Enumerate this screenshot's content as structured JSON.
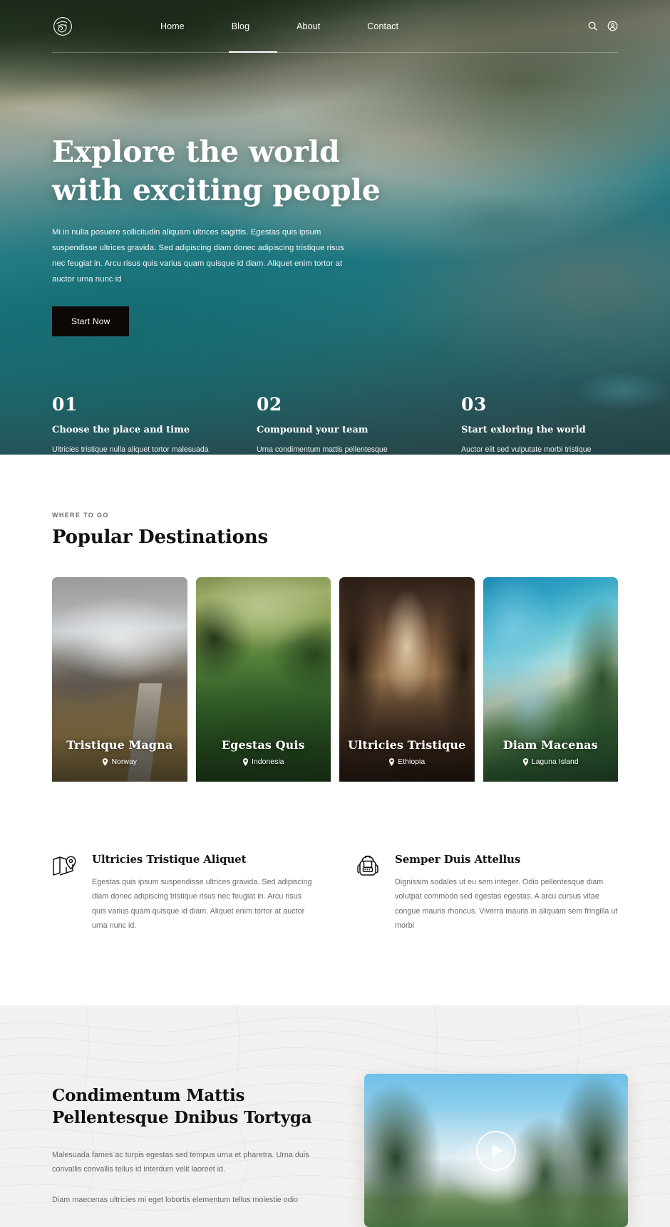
{
  "header": {
    "logo_icon": "wave-circle-logo",
    "nav": [
      {
        "label": "Home",
        "active": true
      },
      {
        "label": "Blog",
        "active": false
      },
      {
        "label": "About",
        "active": false
      },
      {
        "label": "Contact",
        "active": false
      }
    ],
    "actions": [
      {
        "icon": "search-icon"
      },
      {
        "icon": "user-account-icon"
      }
    ]
  },
  "hero": {
    "title_line1": "Explore the world",
    "title_line2": "with exciting people",
    "paragraph": "Mi in nulla posuere sollicitudin aliquam ultrices sagittis. Egestas quis ipsum suspendisse ultrices gravida. Sed adipiscing diam donec adipiscing tristique risus nec feugiat in. Arcu risus quis varius quam quisque id diam. Aliquet enim tortor at auctor urna nunc id",
    "cta_label": "Start Now",
    "cta_bg": "#0d0806",
    "steps": [
      {
        "number": "01",
        "title": "Choose the place and time",
        "text": "Ultricies tristique nulla aliquet tortor malesuada fames ac turpis egestas sed tempus urna."
      },
      {
        "number": "02",
        "title": "Compound your team",
        "text": "Urna condimentum mattis pellentesque placerat vestibulum lectus mauris tortor condimentum."
      },
      {
        "number": "03",
        "title": "Start exloring the world",
        "text": "Auctor elit sed vulputate morbi tristique senectus et netus et malesuada fames ac turpis."
      }
    ]
  },
  "destinations": {
    "eyebrow": "WHERE TO GO",
    "title": "Popular Destinations",
    "cards": [
      {
        "title": "Tristique Magna",
        "location": "Norway",
        "image": "norway-mountain-trail"
      },
      {
        "title": "Egestas Quis",
        "location": "Indonesia",
        "image": "indonesia-tea-fields"
      },
      {
        "title": "Ultricies Tristique",
        "location": "Ethiopia",
        "image": "ethiopia-forest-path"
      },
      {
        "title": "Diam Macenas",
        "location": "Laguna Island",
        "image": "laguna-island-aerial"
      }
    ]
  },
  "features": [
    {
      "icon": "folded-map-pin-icon",
      "title": "Ultricies Tristique Aliquet",
      "text": "Egestas quis ipsum suspendisse ultrices gravida. Sed adipiscing diam donec adipiscing tristique risus nec feugiat in. Arcu risus quis varius quam quisque id diam. Aliquet enim tortor at auctor urna nunc id."
    },
    {
      "icon": "backpack-icon",
      "title": "Semper Duis Attellus",
      "text": "Dignissim sodales ut eu sem integer. Odio pellentesque diam volutpat commodo sed egestas egestas. A arcu cursus vitae congue mauris rhoncus. Viverra mauris in aliquam sem fringilla ut morbi"
    }
  ],
  "video_section": {
    "title_line1": "Condimentum Mattis",
    "title_line2": "Pellentesque Dnibus Tortyga",
    "paragraph1": "Malesuada fames ac turpis egestas sed tempus urna et pharetra. Urna duis convallis convallis tellus id interdum velit laoreet id.",
    "paragraph2": "Diam maecenas ultricies mi eget lobortis elementum tellus molestie odio",
    "play_icon": "play-triangle-icon",
    "thumbnail": "hikers-mountain-forest"
  }
}
